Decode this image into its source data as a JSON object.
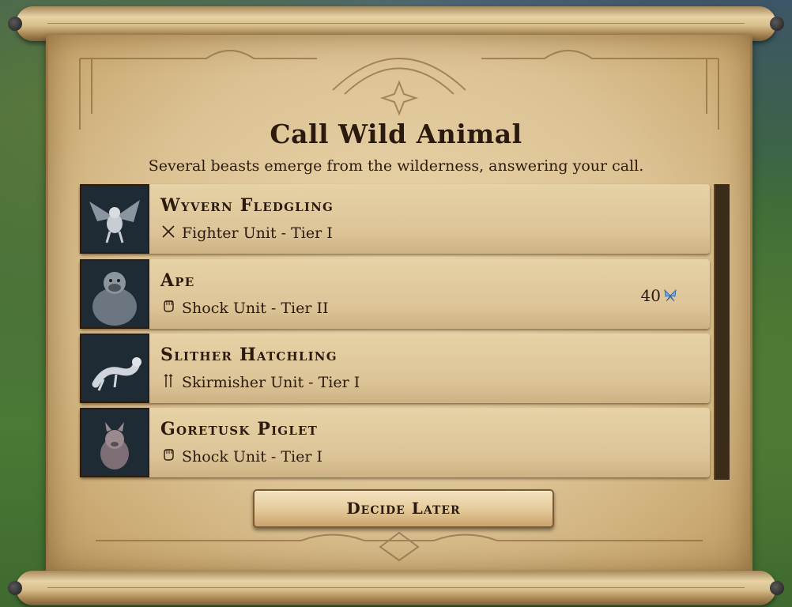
{
  "dialog": {
    "title": "Call Wild Animal",
    "subtitle": "Several beasts emerge from the wilderness, answering your call."
  },
  "units": [
    {
      "name": "Wyvern Fledgling",
      "type": "Fighter Unit - Tier I",
      "type_icon": "crossed-swords-icon",
      "portrait": "wyvern-portrait",
      "cost": null
    },
    {
      "name": "Ape",
      "type": "Shock Unit - Tier II",
      "type_icon": "fist-icon",
      "portrait": "ape-portrait",
      "cost": "40",
      "cost_icon": "mana-butterfly-icon"
    },
    {
      "name": "Slither Hatchling",
      "type": "Skirmisher Unit - Tier I",
      "type_icon": "skirmisher-icon",
      "portrait": "slither-portrait",
      "cost": null
    },
    {
      "name": "Goretusk Piglet",
      "type": "Shock Unit - Tier I",
      "type_icon": "fist-icon",
      "portrait": "piglet-portrait",
      "cost": null
    }
  ],
  "buttons": {
    "decide_later": "Decide Later"
  },
  "colors": {
    "parchment": "#dcc293",
    "ink": "#2b1a0e",
    "mana": "#6fa8e8"
  }
}
